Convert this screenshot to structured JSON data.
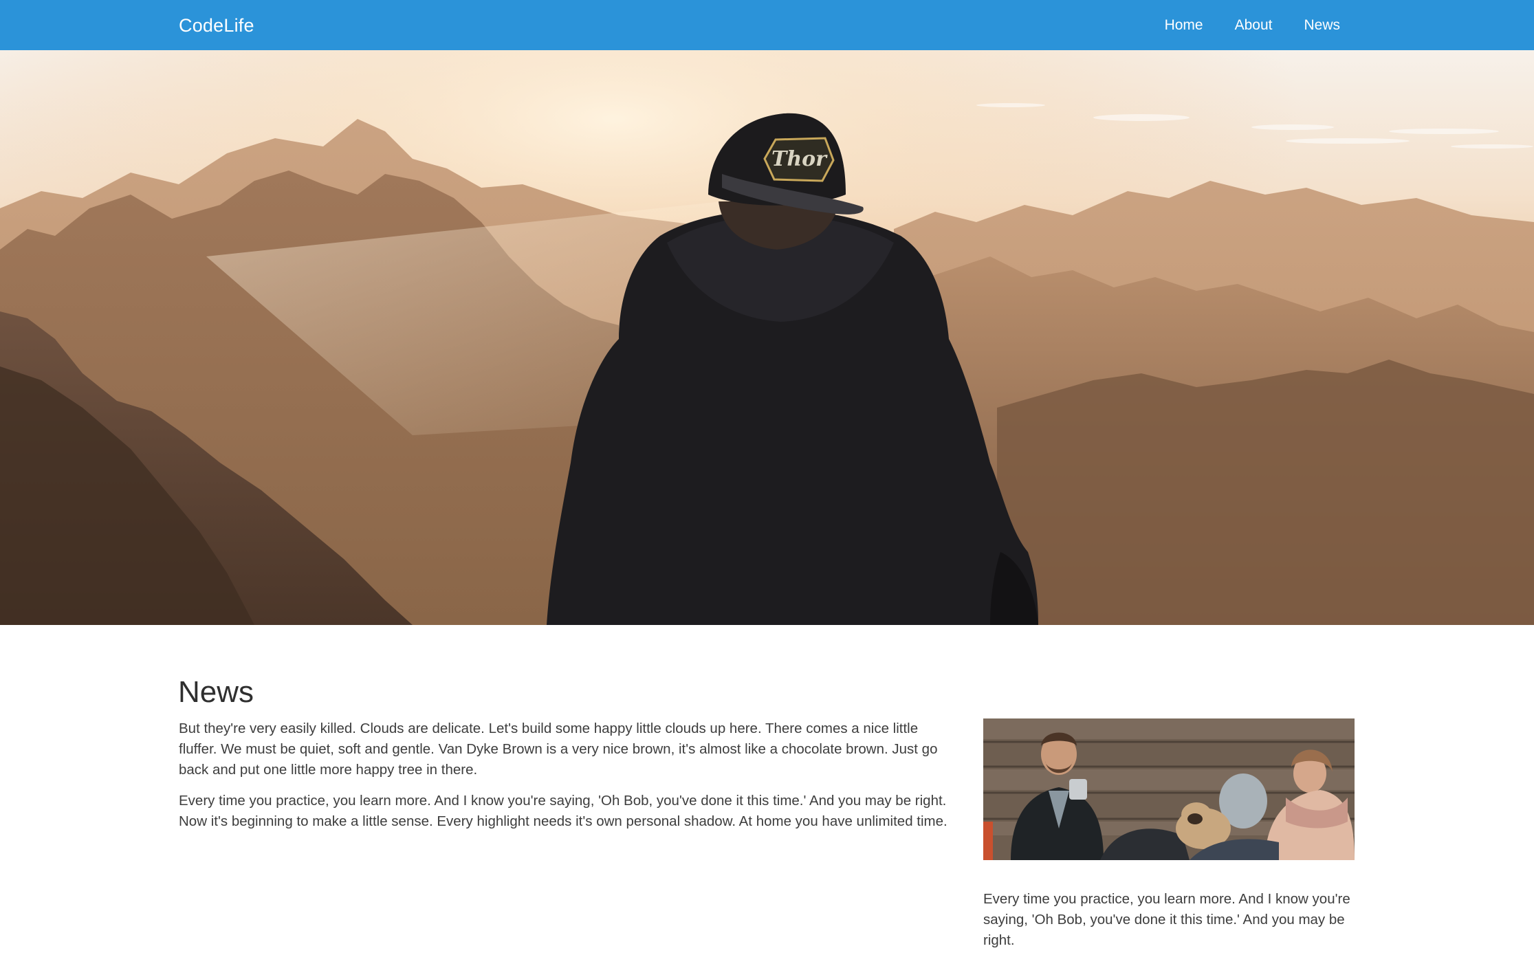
{
  "navbar": {
    "brand": "CodeLife",
    "links": [
      {
        "label": "Home"
      },
      {
        "label": "About"
      },
      {
        "label": "News"
      }
    ],
    "background_color": "#2b93d9"
  },
  "hero": {
    "image": "mountain-sunrise-person-photo",
    "cap_text": "Thor"
  },
  "news": {
    "title": "News",
    "paragraphs": [
      "But they're very easily killed. Clouds are delicate. Let's build some happy little clouds up here. There comes a nice little fluffer. We must be quiet, soft and gentle. Van Dyke Brown is a very nice brown, it's almost like a chocolate brown. Just go back and put one little more happy tree in there.",
      "Every time you practice, you learn more. And I know you're saying, 'Oh Bob, you've done it this time.' And you may be right. Now it's beginning to make a little sense. Every highlight needs it's own personal shadow. At home you have unlimited time."
    ],
    "side_image": "couple-with-pug-photo",
    "side_paragraph": "Every time you practice, you learn more. And I know you're saying, 'Oh Bob, you've done it this time.' And you may be right."
  }
}
